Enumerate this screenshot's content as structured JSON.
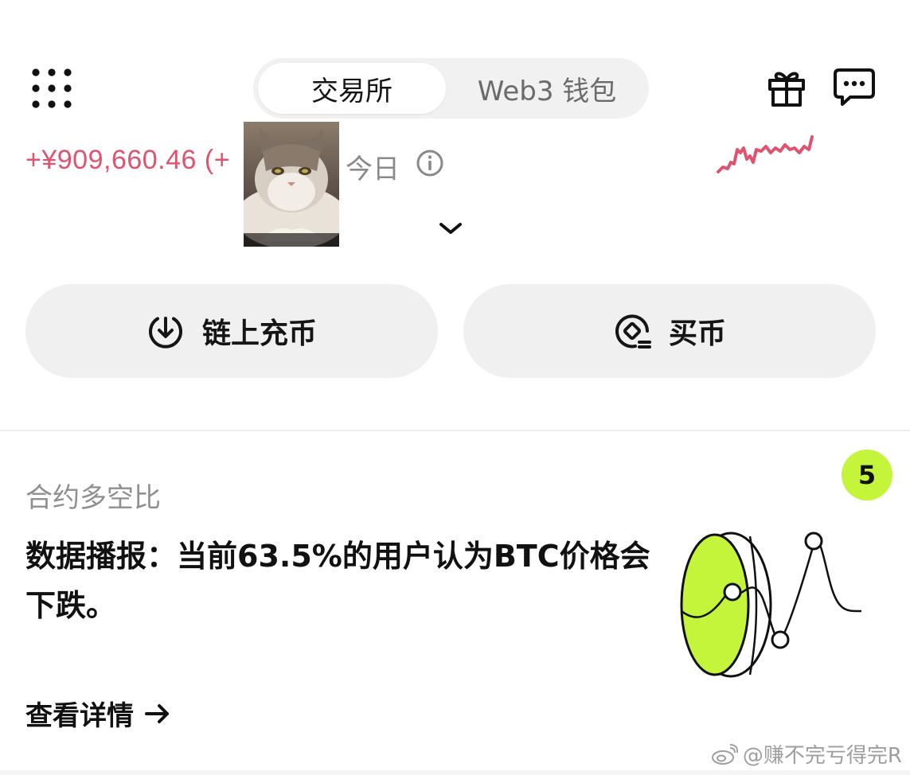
{
  "header": {
    "tabs": [
      {
        "label": "交易所",
        "active": true
      },
      {
        "label": "Web3 钱包",
        "active": false
      }
    ]
  },
  "summary": {
    "pnl_text": "+¥909,660.46 (+",
    "period_label": "今日",
    "pnl_color": "#e0536f"
  },
  "actions": {
    "deposit_label": "链上充币",
    "buy_label": "买币"
  },
  "card": {
    "title": "合约多空比",
    "badge": "5",
    "headline": "数据播报：当前63.5%的用户认为BTC价格会下跌。",
    "details_label": "查看详情",
    "accent_color": "#c4f53b"
  },
  "watermark": "@赚不完亏得完R"
}
